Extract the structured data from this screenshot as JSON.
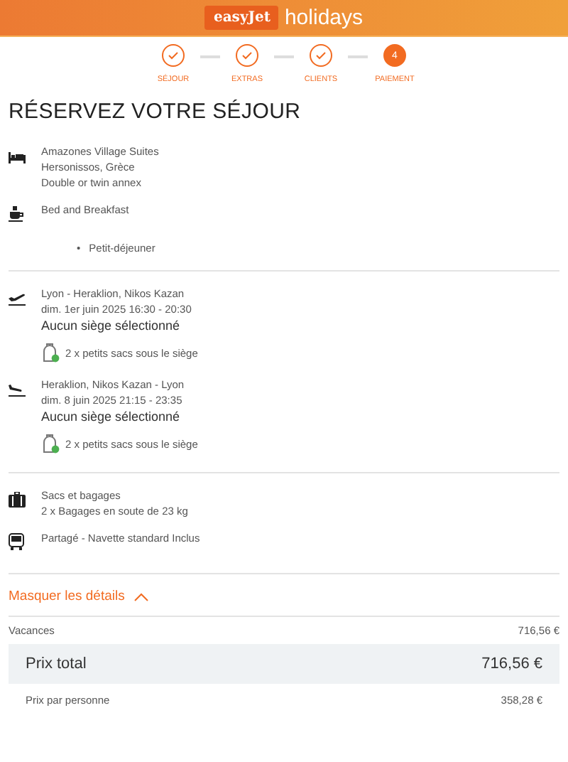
{
  "header": {
    "logo": "easyJet",
    "brand": "holidays"
  },
  "steps": [
    {
      "label": "SÉJOUR",
      "completed": true
    },
    {
      "label": "EXTRAS",
      "completed": true
    },
    {
      "label": "CLIENTS",
      "completed": true
    },
    {
      "label": "PAIEMENT",
      "completed": false,
      "number": "4"
    }
  ],
  "title": "RÉSERVEZ VOTRE SÉJOUR",
  "groups": [
    [
      {
        "kind": "hotel",
        "lines": [
          "Amazones Village Suites",
          "Hersonissos, Grèce",
          "Double or twin annex"
        ]
      },
      {
        "kind": "meal",
        "lines": [
          "Bed and Breakfast"
        ],
        "bullets": [
          {
            "marker": "•",
            "text": "Petit-déjeuner"
          }
        ]
      }
    ],
    [
      {
        "kind": "departure",
        "lines": [
          "Lyon - Heraklion, Nikos Kazan",
          "dim. 1er juin 2025 16:30 - 20:30"
        ],
        "seat": "Aucun siège sélectionné",
        "bag": "2 x petits sacs sous le siège"
      },
      {
        "kind": "arrival",
        "lines": [
          "Heraklion, Nikos Kazan - Lyon",
          "dim. 8 juin 2025 21:15 - 23:35"
        ],
        "seat": "Aucun siège sélectionné",
        "bag": "2 x petits sacs sous le siège"
      }
    ],
    [
      {
        "kind": "luggage",
        "lines": [
          "Sacs et bagages",
          "2 x Bagages en soute de 23 kg"
        ]
      },
      {
        "kind": "bus",
        "lines": [
          "Partagé - Navette standard Inclus"
        ]
      }
    ]
  ],
  "toggle": {
    "label": "Masquer les détails",
    "expanded": true
  },
  "prices": [
    {
      "kind": "line",
      "label": "Vacances",
      "value": "716,56 €"
    },
    {
      "kind": "total",
      "label": "Prix total",
      "value": "716,56 €"
    },
    {
      "kind": "sub",
      "label": "Prix par personne",
      "value": "358,28 €"
    }
  ]
}
